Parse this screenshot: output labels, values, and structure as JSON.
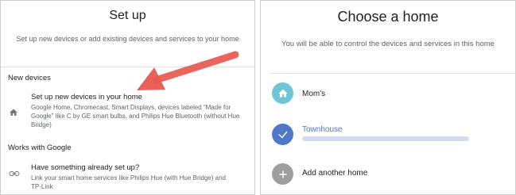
{
  "setup": {
    "title": "Set up",
    "subtitle": "Set up new devices or add existing devices and services to your home",
    "new_devices_header": "New devices",
    "new_item_title": "Set up new devices in your home",
    "new_item_desc_lines": [
      "Google Home, Chromecast, Smart Displays, devices labeled “Made for",
      "Google” like C by GE smart bulbs, and Philips Hue Bluetooth (without Hue",
      "Bridge)"
    ],
    "works_header": "Works with Google",
    "works_item_title": "Have something already set up?",
    "works_item_desc_lines": [
      "Link your smart home services like Philips Hue (with Hue Bridge) and",
      "TP-Link"
    ]
  },
  "choose": {
    "title": "Choose a home",
    "subtitle": "You will be able to control the devices and services in this home",
    "homes": [
      {
        "label": "Mom's",
        "icon": "home-icon",
        "color": "#6ec6d4"
      },
      {
        "label": "Townhouse",
        "icon": "check-icon",
        "color": "#4f78c9",
        "selected": true
      },
      {
        "label": "Add another home",
        "icon": "plus-icon",
        "color": "#9e9e9e"
      }
    ]
  },
  "colors": {
    "arrow": "#e8594f",
    "accent": "#4f78c9"
  }
}
